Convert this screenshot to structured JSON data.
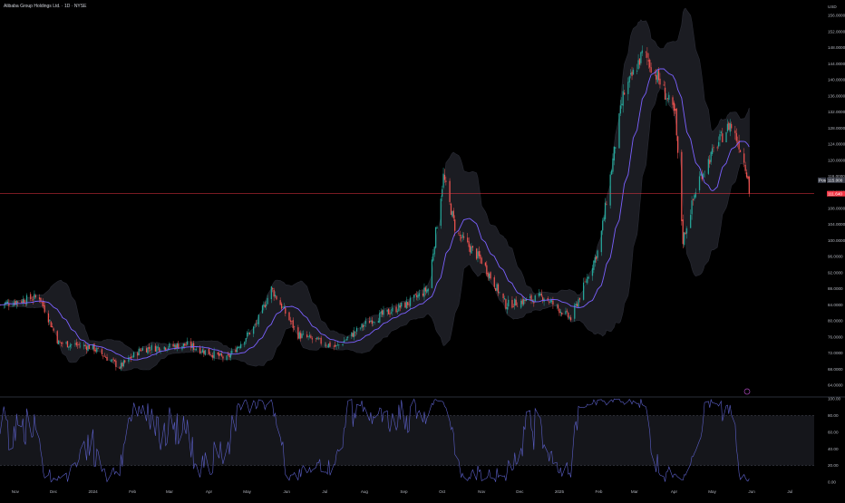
{
  "header": {
    "title": "Alibaba Group Holdings Ltd. · 1D · NYSE"
  },
  "colors": {
    "background": "#000000",
    "up": "#26a69a",
    "down": "#ef5350",
    "basis": "#7b61ff",
    "band_fill": "#1b1c22",
    "band_edge": "#2a2c36",
    "osc_line": "#5b5fc7",
    "price_line": "#f23645"
  },
  "currency_label": "USD",
  "current_price": {
    "text": "111.640",
    "prev_text": "115.000",
    "prev_tag": "Pos"
  },
  "chart_data": [
    {
      "type": "candlestick",
      "title": "Alibaba Group Holdings Ltd. · 1D · NYSE",
      "y_ticks": [
        "156.0000",
        "152.0000",
        "148.0000",
        "144.0000",
        "140.0000",
        "136.0000",
        "132.0000",
        "128.0000",
        "124.0000",
        "120.0000",
        "116.0000",
        "112.0000",
        "108.0000",
        "104.0000",
        "100.0000",
        "96.0000",
        "92.0000",
        "88.0000",
        "84.0000",
        "80.0000",
        "76.0000",
        "72.0000",
        "68.0000",
        "64.0000"
      ],
      "ylim": [
        61.5,
        158.5
      ],
      "x_labels": [
        "Nov",
        "Dec",
        "2024",
        "Feb",
        "Mar",
        "Apr",
        "May",
        "Jun",
        "Jul",
        "Aug",
        "Sep",
        "Oct",
        "Nov",
        "Dec",
        "2025",
        "Feb",
        "Mar",
        "Apr",
        "May",
        "Jun",
        "Jul"
      ],
      "x_label_dates": [
        "2023-11-01",
        "2023-12-01",
        "2024-01-01",
        "2024-02-01",
        "2024-03-01",
        "2024-04-01",
        "2024-05-01",
        "2024-06-01",
        "2024-07-01",
        "2024-08-01",
        "2024-09-01",
        "2024-10-01",
        "2024-11-01",
        "2024-12-01",
        "2025-01-01",
        "2025-02-01",
        "2025-03-01",
        "2025-04-01",
        "2025-05-01",
        "2025-06-01",
        "2025-07-01"
      ],
      "x_range": [
        "2023-10-20",
        "2025-07-20"
      ],
      "price_keypoints": [
        [
          "2023-10-20",
          84.0
        ],
        [
          "2023-11-20",
          86.0
        ],
        [
          "2023-12-05",
          74.5
        ],
        [
          "2023-12-31",
          73.5
        ],
        [
          "2024-01-22",
          68.5
        ],
        [
          "2024-02-08",
          73.0
        ],
        [
          "2024-03-15",
          74.0
        ],
        [
          "2024-04-15",
          70.5
        ],
        [
          "2024-05-08",
          79.0
        ],
        [
          "2024-05-20",
          88.0
        ],
        [
          "2024-06-10",
          76.5
        ],
        [
          "2024-07-10",
          73.5
        ],
        [
          "2024-08-05",
          80.0
        ],
        [
          "2024-09-05",
          84.5
        ],
        [
          "2024-09-20",
          88.0
        ],
        [
          "2024-10-02",
          116.0
        ],
        [
          "2024-10-12",
          102.0
        ],
        [
          "2024-11-01",
          95.0
        ],
        [
          "2024-11-20",
          84.0
        ],
        [
          "2024-12-20",
          86.0
        ],
        [
          "2025-01-10",
          80.5
        ],
        [
          "2025-02-01",
          98.0
        ],
        [
          "2025-02-20",
          136.0
        ],
        [
          "2025-03-08",
          147.0
        ],
        [
          "2025-03-20",
          140.0
        ],
        [
          "2025-04-02",
          131.0
        ],
        [
          "2025-04-08",
          100.0
        ],
        [
          "2025-04-20",
          115.0
        ],
        [
          "2025-05-05",
          124.0
        ],
        [
          "2025-05-15",
          129.0
        ],
        [
          "2025-05-22",
          124.0
        ],
        [
          "2025-05-30",
          115.0
        ]
      ],
      "last_price": 111.64,
      "prev_close": 115.0,
      "bollinger_period": 20,
      "bollinger_stddev": 2
    },
    {
      "type": "line",
      "title": "",
      "y_ticks": [
        "100.00",
        "80.00",
        "60.00",
        "40.00",
        "20.00",
        "0.00"
      ],
      "ylim": [
        0,
        100
      ],
      "band_levels": [
        80,
        20
      ],
      "derived_from": "price stochastic oscillator"
    }
  ]
}
